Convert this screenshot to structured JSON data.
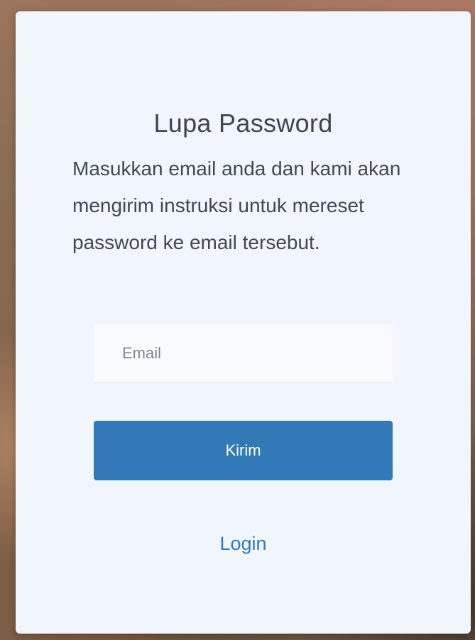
{
  "form": {
    "title": "Lupa Password",
    "description": "Masukkan email anda dan kami akan mengirim instruksi untuk mereset password ke email tersebut.",
    "email_placeholder": "Email",
    "email_value": "",
    "submit_label": "Kirim",
    "login_link_label": "Login"
  },
  "colors": {
    "card_background": "#f1f6fd",
    "primary": "#3279b7",
    "text": "#3f4852"
  }
}
